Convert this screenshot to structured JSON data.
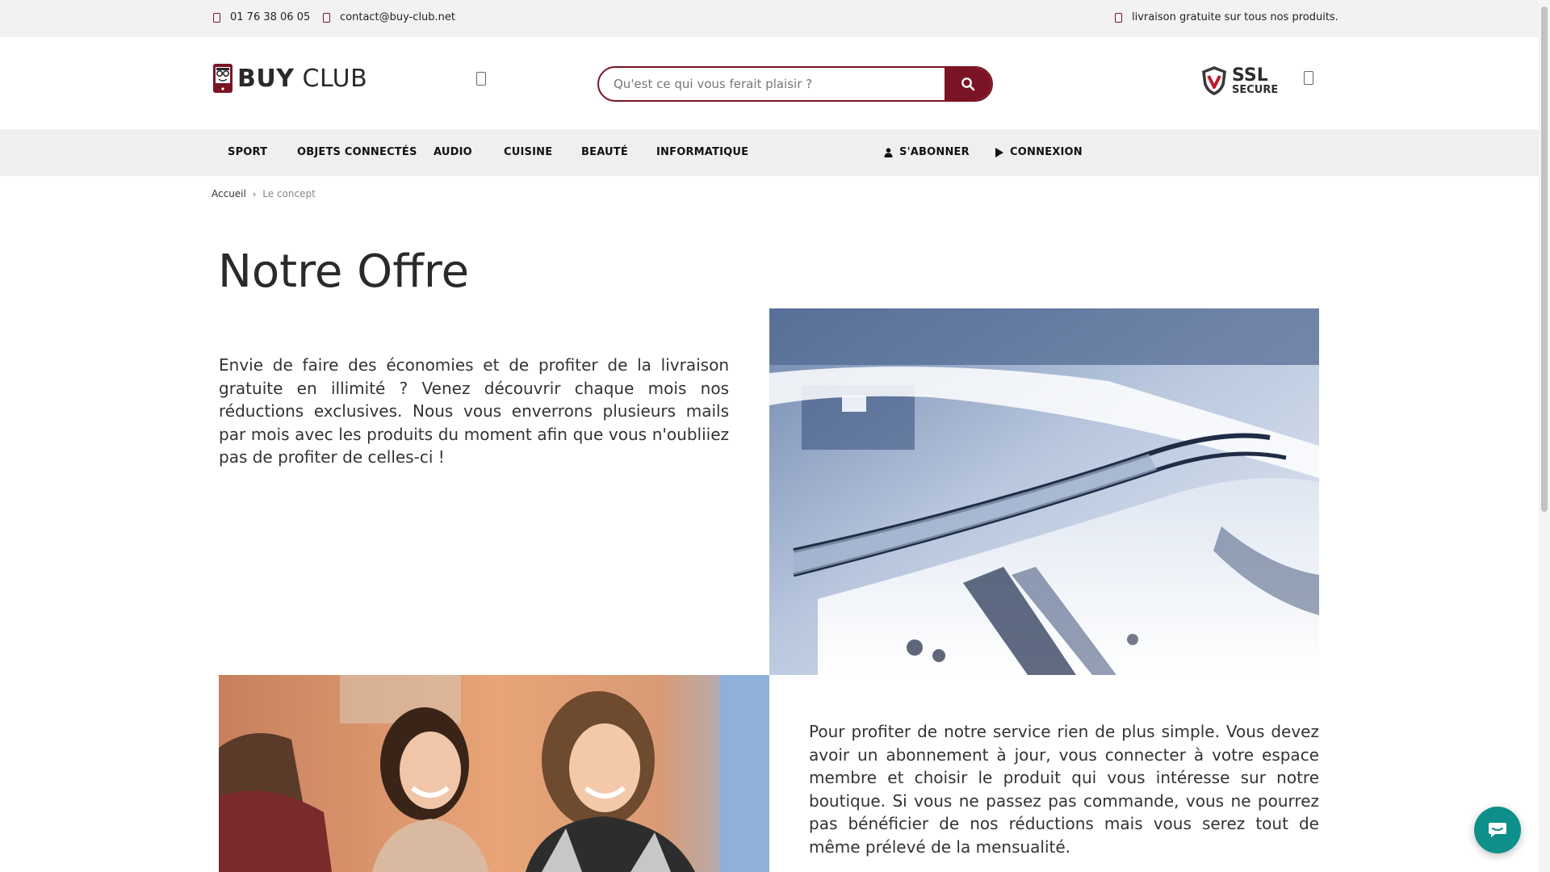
{
  "topbar": {
    "phone": "01 76 38 06 05",
    "email": "contact@buy-club.net",
    "shipping": "livraison gratuite sur tous nos produits."
  },
  "header": {
    "logo_bold": "BUY",
    "logo_light": "CLUB",
    "search_placeholder": "Qu'est ce qui vous ferait plaisir ?",
    "ssl_line1": "SSL",
    "ssl_line2": "SECURE"
  },
  "nav": {
    "items": [
      "SPORT",
      "OBJETS CONNECTÉS",
      "AUDIO",
      "CUISINE",
      "BEAUTÉ",
      "INFORMATIQUE"
    ],
    "subscribe": "S'ABONNER",
    "login": "CONNEXION"
  },
  "breadcrumb": {
    "home": "Accueil",
    "current": "Le concept"
  },
  "main": {
    "title": "Notre Offre",
    "paragraph1": "Envie de faire des économies et de profiter de la livraison gratuite en illimité ? Venez découvrir chaque mois nos réductions exclusives. Nous vous enverrons plusieurs mails par mois avec les produits du moment afin que vous n'oubliiez pas de profiter de celles-ci !",
    "paragraph2": "Pour profiter de notre service rien de plus simple. Vous devez avoir un abonnement à jour, vous connecter à votre espace membre et choisir le produit qui vous intéresse sur notre boutique. Si vous ne passez pas commande, vous ne pourrez pas bénéficier de nos réductions mais vous serez tout de même prélevé de la mensualité."
  },
  "colors": {
    "brand": "#7a1425",
    "chat": "#0e8f8a"
  }
}
